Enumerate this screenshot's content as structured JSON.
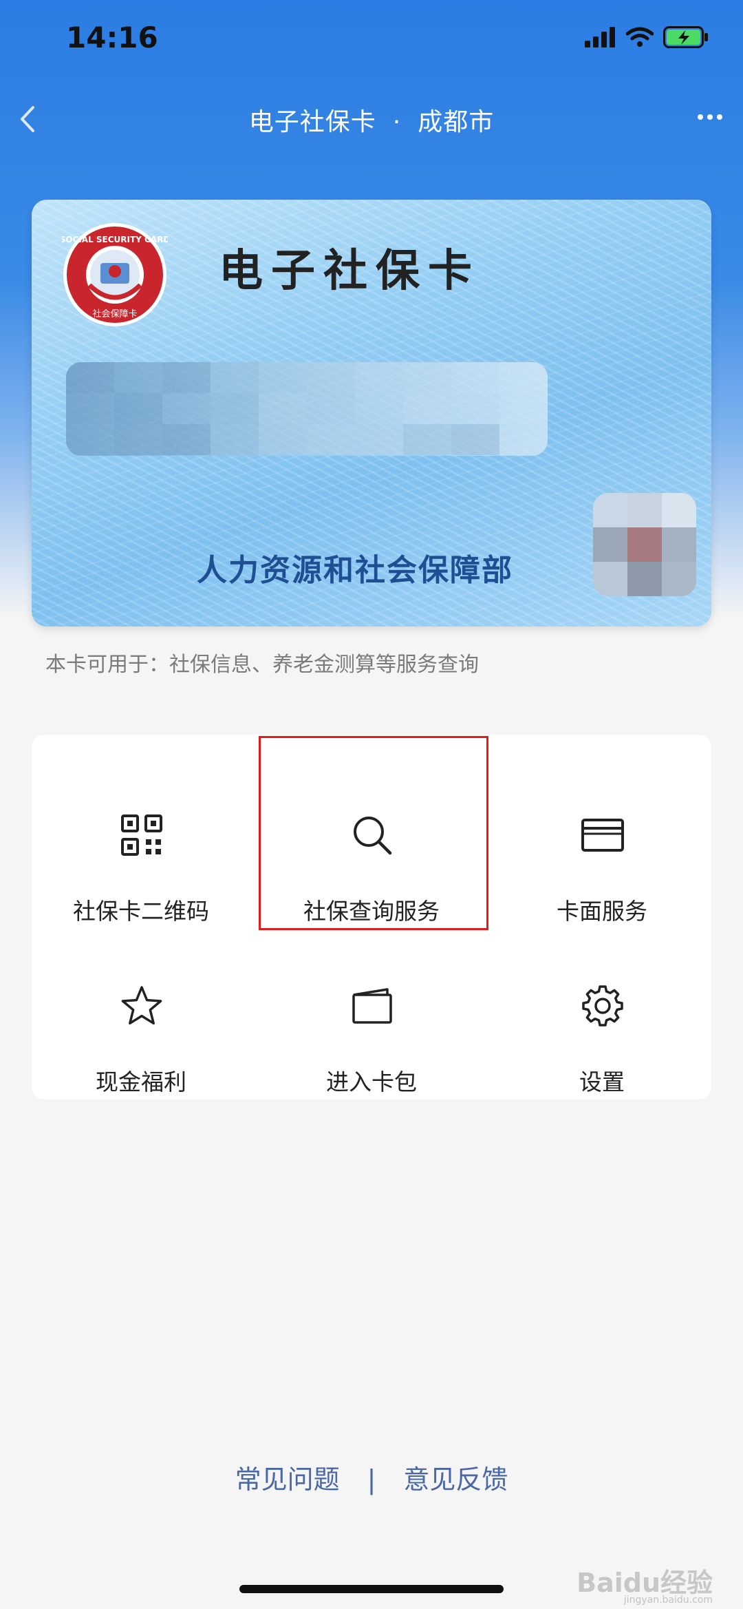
{
  "status_bar": {
    "time": "14:16"
  },
  "nav": {
    "title": "电子社保卡",
    "separator": "·",
    "city": "成都市"
  },
  "card": {
    "title": "电子社保卡",
    "logo_text": "SOCIAL SECURITY CARD",
    "logo_cn": "社会保障卡",
    "issuer": "人力资源和社会保障部"
  },
  "card_usage": "本卡可用于：社保信息、养老金测算等服务查询",
  "menu": {
    "items": [
      {
        "label": "社保卡二维码",
        "icon": "qr-code-icon"
      },
      {
        "label": "社保查询服务",
        "icon": "search-icon"
      },
      {
        "label": "卡面服务",
        "icon": "card-icon"
      },
      {
        "label": "现金福利",
        "icon": "star-icon"
      },
      {
        "label": "进入卡包",
        "icon": "wallet-card-icon"
      },
      {
        "label": "设置",
        "icon": "gear-icon"
      }
    ]
  },
  "footer": {
    "faq": "常见问题",
    "separator": "|",
    "feedback": "意见反馈"
  },
  "watermark": {
    "brand": "Baidu经验",
    "url": "jingyan.baidu.com"
  },
  "colors": {
    "accent": "#2c7de3",
    "highlight": "#e31b1b",
    "footer_link": "#4a68a6"
  }
}
